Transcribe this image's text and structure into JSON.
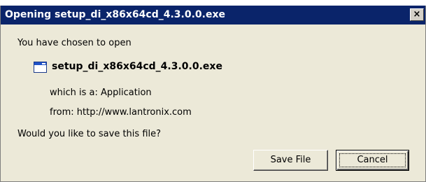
{
  "dialog": {
    "title": "Opening setup_di_x86x64cd_4.3.0.0.exe",
    "close_label": "×",
    "intro": "You have chosen to open",
    "file_icon": "application-window-icon",
    "file_name": "setup_di_x86x64cd_4.3.0.0.exe",
    "which_is": "which is a:  Application",
    "from": "from:  http://www.lantronix.com",
    "question": "Would you like to save this file?",
    "buttons": {
      "save": "Save File",
      "cancel": "Cancel"
    }
  },
  "colors": {
    "titlebar": "#0a246a",
    "face": "#ece9d8"
  }
}
